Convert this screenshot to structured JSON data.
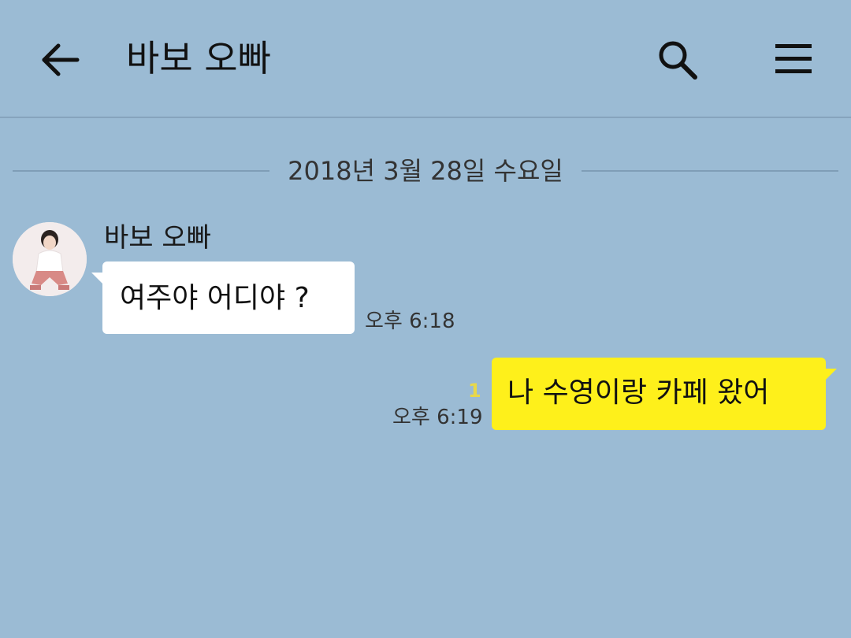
{
  "header": {
    "back_icon": "arrow-left-icon",
    "title": "바보 오빠",
    "search_icon": "search-icon",
    "menu_icon": "hamburger-menu-icon"
  },
  "date_divider": {
    "text": "2018년 3월 28일 수요일"
  },
  "messages": [
    {
      "direction": "incoming",
      "sender": "바보 오빠",
      "text": "여주야 어디야 ?",
      "time": "오후 6:18"
    },
    {
      "direction": "outgoing",
      "text": "나 수영이랑 카페 왔어",
      "time": "오후 6:19",
      "unread": "1"
    }
  ],
  "colors": {
    "background": "#9bbbd4",
    "incoming_bubble": "#ffffff",
    "outgoing_bubble": "#fef01b",
    "unread": "#e8d84a"
  }
}
